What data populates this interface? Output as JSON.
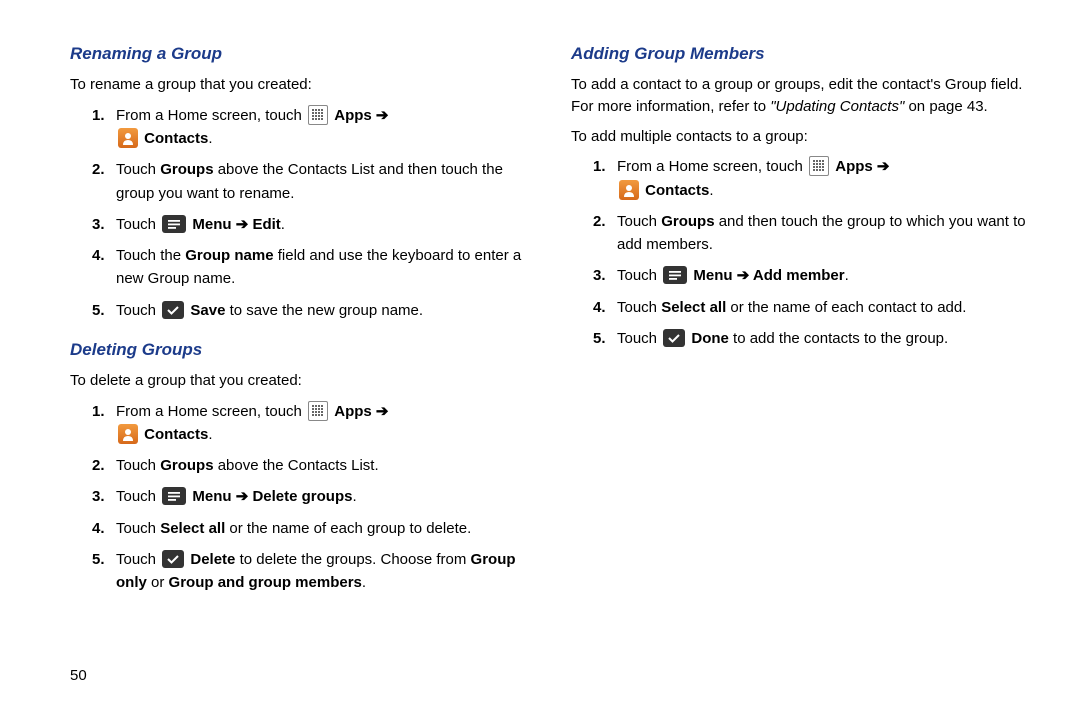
{
  "page_number": "50",
  "left": {
    "section1": {
      "heading": "Renaming a Group",
      "intro": "To rename a group that you created:",
      "step1_a": "From a Home screen, touch ",
      "step1_apps": "Apps",
      "step1_arrow": " ➔ ",
      "step1_contacts": "Contacts",
      "step1_end": ".",
      "step2_a": "Touch ",
      "step2_b": "Groups",
      "step2_c": " above the Contacts List and then touch the group you want to rename.",
      "step3_a": "Touch ",
      "step3_menu": "Menu",
      "step3_arrow": " ➔ ",
      "step3_edit": "Edit",
      "step3_end": ".",
      "step4_a": "Touch the ",
      "step4_b": "Group name",
      "step4_c": " field and use the keyboard to enter a new Group name.",
      "step5_a": "Touch ",
      "step5_save": "Save",
      "step5_c": " to save the new group name."
    },
    "section2": {
      "heading": "Deleting Groups",
      "intro": "To delete a group that you created:",
      "step1_a": "From a Home screen, touch ",
      "step1_apps": "Apps",
      "step1_arrow": " ➔ ",
      "step1_contacts": "Contacts",
      "step1_end": ".",
      "step2_a": "Touch ",
      "step2_b": "Groups",
      "step2_c": " above the Contacts List.",
      "step3_a": "Touch ",
      "step3_menu": "Menu",
      "step3_arrow": " ➔ ",
      "step3_del": "Delete groups",
      "step3_end": ".",
      "step4_a": "Touch ",
      "step4_b": "Select all",
      "step4_c": " or the name of each group to delete.",
      "step5_a": "Touch ",
      "step5_del": "Delete",
      "step5_b": " to delete the groups. Choose from ",
      "step5_c": "Group only",
      "step5_d": " or ",
      "step5_e": "Group and group members",
      "step5_f": "."
    }
  },
  "right": {
    "section1": {
      "heading": "Adding Group Members",
      "intro_a": "To add a contact to a group or groups, edit the contact's Group field. For more information, refer to ",
      "intro_b": "\"Updating Contacts\"",
      "intro_c": " on page 43.",
      "intro2": "To add multiple contacts to a group:",
      "step1_a": "From a Home screen, touch ",
      "step1_apps": "Apps",
      "step1_arrow": " ➔ ",
      "step1_contacts": "Contacts",
      "step1_end": ".",
      "step2_a": "Touch ",
      "step2_b": "Groups",
      "step2_c": " and then touch the group to which you want to add members.",
      "step3_a": "Touch ",
      "step3_menu": "Menu",
      "step3_arrow": " ➔ ",
      "step3_add": "Add member",
      "step3_end": ".",
      "step4_a": "Touch ",
      "step4_b": "Select all",
      "step4_c": " or the name of each contact to add.",
      "step5_a": "Touch ",
      "step5_done": "Done",
      "step5_c": " to add the contacts to the group."
    }
  }
}
